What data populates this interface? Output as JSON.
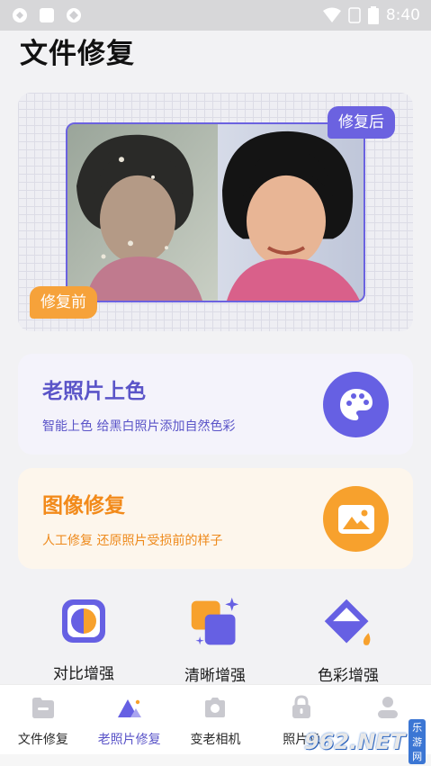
{
  "status_bar": {
    "time": "8:40"
  },
  "page": {
    "title": "文件修复"
  },
  "hero": {
    "after_badge": "修复后",
    "before_badge": "修复前"
  },
  "cards": [
    {
      "title": "老照片上色",
      "subtitle": "智能上色 给黑白照片添加自然色彩",
      "icon": "palette-icon",
      "color": "#6660e3"
    },
    {
      "title": "图像修复",
      "subtitle": "人工修复 还原照片受损前的样子",
      "icon": "image-mountain-icon",
      "color": "#f7a12d"
    }
  ],
  "tools": [
    {
      "label": "对比增强",
      "icon": "contrast-icon"
    },
    {
      "label": "清晰增强",
      "icon": "sharpen-icon"
    },
    {
      "label": "色彩增强",
      "icon": "paint-bucket-icon"
    }
  ],
  "bottom_nav": {
    "active_index": 1,
    "items": [
      {
        "label": "文件修复",
        "icon": "folder-icon"
      },
      {
        "label": "老照片修复",
        "icon": "mountain-icon"
      },
      {
        "label": "变老相机",
        "icon": "camera-icon"
      },
      {
        "label": "照片隐",
        "icon": "lock-icon"
      },
      {
        "label": "",
        "icon": "person-icon"
      }
    ]
  },
  "watermark": {
    "number": "962.NET",
    "site": "乐游网"
  },
  "colors": {
    "accent_purple": "#6660e3",
    "accent_orange": "#f7a12d"
  }
}
